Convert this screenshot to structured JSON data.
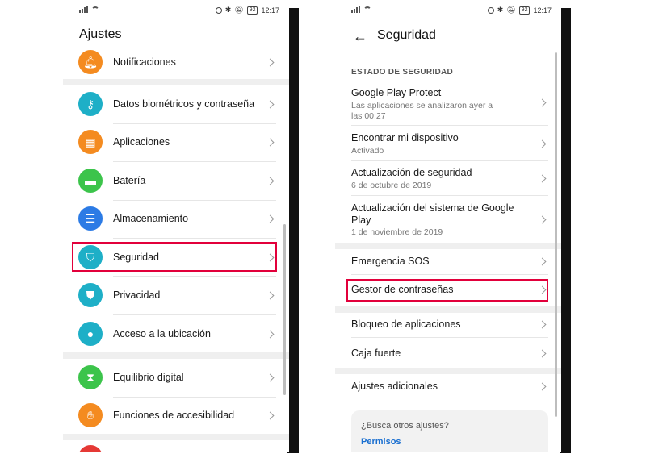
{
  "status_bar": {
    "time": "12:17",
    "battery": "92"
  },
  "left": {
    "title": "Ajustes",
    "items": [
      {
        "label": "Notificaciones",
        "icon": "bell-icon",
        "color": "#F48B20"
      },
      {
        "label": "Datos biométricos y contraseña",
        "icon": "key-icon",
        "color": "#1EAFC7"
      },
      {
        "label": "Aplicaciones",
        "icon": "apps-grid-icon",
        "color": "#F48B20"
      },
      {
        "label": "Batería",
        "icon": "battery-icon",
        "color": "#3CC44B"
      },
      {
        "label": "Almacenamiento",
        "icon": "storage-icon",
        "color": "#2C7BE5"
      },
      {
        "label": "Seguridad",
        "icon": "shield-icon",
        "color": "#1EAFC7"
      },
      {
        "label": "Privacidad",
        "icon": "privacy-shield-icon",
        "color": "#1EAFC7"
      },
      {
        "label": "Acceso a la ubicación",
        "icon": "location-pin-icon",
        "color": "#1EAFC7"
      },
      {
        "label": "Equilibrio digital",
        "icon": "hourglass-icon",
        "color": "#3CC44B"
      },
      {
        "label": "Funciones de accesibilidad",
        "icon": "hand-icon",
        "color": "#F48B20"
      }
    ]
  },
  "right": {
    "title": "Seguridad",
    "section": "ESTADO DE SEGURIDAD",
    "status_items": [
      {
        "label": "Google Play Protect",
        "sub": "Las aplicaciones se analizaron ayer a las 00:27"
      },
      {
        "label": "Encontrar mi dispositivo",
        "sub": "Activado"
      },
      {
        "label": "Actualización de seguridad",
        "sub": "6 de octubre de 2019"
      },
      {
        "label": "Actualización del sistema de Google Play",
        "sub": "1 de noviembre de 2019"
      }
    ],
    "items": [
      {
        "label": "Emergencia SOS"
      },
      {
        "label": "Gestor de contraseñas"
      },
      {
        "label": "Bloqueo de aplicaciones"
      },
      {
        "label": "Caja fuerte"
      },
      {
        "label": "Ajustes adicionales"
      }
    ],
    "card": {
      "question": "¿Busca otros ajustes?",
      "link": "Permisos"
    }
  },
  "highlight_color": "#E2003B"
}
